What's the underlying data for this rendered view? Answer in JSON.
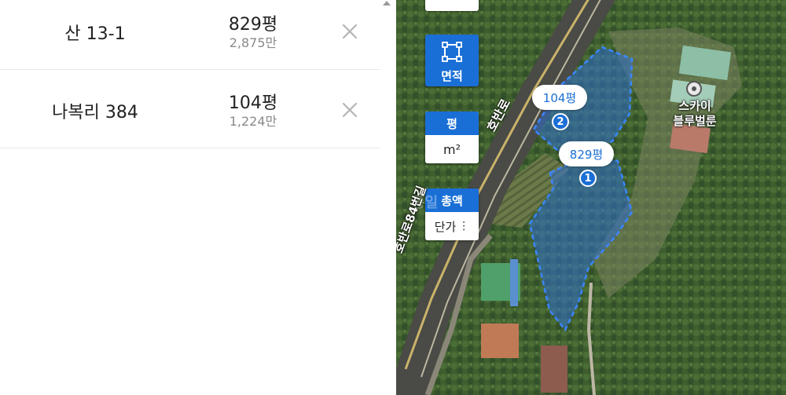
{
  "list": {
    "rows": [
      {
        "address": "산 13-1",
        "area": "829평",
        "price": "2,875만"
      },
      {
        "address": "나복리 384",
        "area": "104평",
        "price": "1,224만"
      }
    ]
  },
  "map": {
    "controls": {
      "area_button_label": "면적",
      "unit_pyeong_label": "평",
      "unit_m2_label": "m²",
      "total_label": "총액",
      "unit_price_label": "단가"
    },
    "road_labels": [
      "호반로",
      "호반로84번길"
    ],
    "faint_label": "통일",
    "parcels": [
      {
        "area_label": "104평",
        "number": "2"
      },
      {
        "area_label": "829평",
        "number": "1"
      }
    ],
    "poi": {
      "name_line1": "스카이",
      "name_line2": "블루벌룬"
    }
  },
  "colors": {
    "accent": "#1a6fd6",
    "parcel_fill": "#2f6fd0",
    "muted_text": "#8a8a8a"
  }
}
